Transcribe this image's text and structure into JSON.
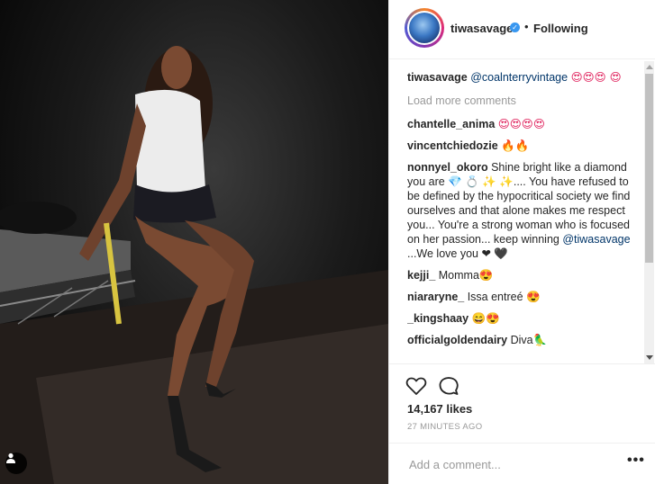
{
  "post": {
    "username": "tiwasavage",
    "follow_status": "Following",
    "caption": {
      "user": "tiwasavage",
      "mention": "@coalnterryvintage",
      "emoji": "😍😍😍 😍"
    },
    "load_more": "Load more comments",
    "comments": [
      {
        "user": "chantelle_anima",
        "text": "😍😍😍😍"
      },
      {
        "user": "vincentchiedozie",
        "text": "🔥🔥"
      },
      {
        "user": "nonnyel_okoro",
        "text_before": " Shine bright like a diamond you are 💎 💍 ✨ ✨.... You have refused to be defined by the hypocritical society we find ourselves and that alone makes me respect you... You're a strong woman who is focused on her passion... keep winning ",
        "mention": "@tiwasavage",
        "text_after": " ...We love you ❤ 🖤"
      },
      {
        "user": "kejji_",
        "text": " Momma😍"
      },
      {
        "user": "niararyne_",
        "text": " Issa entreé 😍"
      },
      {
        "user": "_kingshaay",
        "text": " 😄😍"
      },
      {
        "user": "officialgoldendairy",
        "text": " Diva🦜"
      }
    ],
    "likes": "14,167 likes",
    "timestamp": "27 MINUTES AGO",
    "add_comment_placeholder": "Add a comment...",
    "more_label": "•••"
  },
  "icons": {
    "like": "heart-icon",
    "comment": "speech-bubble-icon",
    "user_tag": "user-tag-icon",
    "verified": "verified-badge-icon"
  },
  "colors": {
    "verified": "#3897f0",
    "link": "#003569",
    "muted": "#999999"
  }
}
